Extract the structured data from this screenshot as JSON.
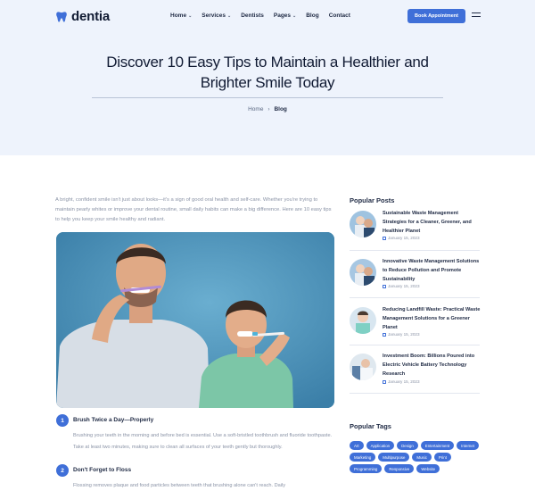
{
  "brand": {
    "name": "dentia",
    "accent": "#3f6fd8"
  },
  "nav": {
    "items": [
      {
        "label": "Home",
        "dropdown": true
      },
      {
        "label": "Services",
        "dropdown": true
      },
      {
        "label": "Dentists",
        "dropdown": false
      },
      {
        "label": "Pages",
        "dropdown": true
      },
      {
        "label": "Blog",
        "dropdown": false
      },
      {
        "label": "Contact",
        "dropdown": false
      }
    ],
    "cta": "Book Appointment",
    "menu_icon": "hamburger-icon"
  },
  "hero": {
    "title": "Discover 10 Easy Tips to Maintain a Healthier and Brighter Smile Today",
    "breadcrumb": {
      "home": "Home",
      "separator": "›",
      "current": "Blog"
    }
  },
  "article": {
    "intro": "A bright, confident smile isn't just about looks—it's a sign of good oral health and self-care. Whether you're trying to maintain pearly whites or improve your dental routine, small daily habits can make a big difference. Here are 10 easy tips to help you keep your smile healthy and radiant.",
    "steps": [
      {
        "number": "1",
        "title": "Brush Twice a Day—Properly",
        "text": "Brushing your teeth in the morning and before bed is essential. Use a soft-bristled toothbrush and fluoride toothpaste. Take at least two minutes, making sure to clean all surfaces of your teeth gently but thoroughly."
      },
      {
        "number": "2",
        "title": "Don't Forget to Floss",
        "text": "Flossing removes plaque and food particles between teeth that brushing alone can't reach. Daily"
      }
    ]
  },
  "sidebar": {
    "popular_posts_heading": "Popular Posts",
    "posts": [
      {
        "title": "Sustainable Waste Management Strategies for a Cleaner, Greener, and Healthier Planet",
        "date": "January 15, 2023"
      },
      {
        "title": "Innovative Waste Management Solutions to Reduce Pollution and Promote Sustainability",
        "date": "January 15, 2023"
      },
      {
        "title": "Reducing Landfill Waste: Practical Waste Management Solutions for a Greener Planet",
        "date": "January 15, 2023"
      },
      {
        "title": "Investment Boom: Billions Poured into Electric Vehicle Battery Technology Research",
        "date": "January 15, 2023"
      }
    ],
    "popular_tags_heading": "Popular Tags",
    "tags": [
      "Art",
      "Application",
      "Design",
      "Entertainment",
      "Internet",
      "Marketing",
      "Multipurpose",
      "Music",
      "Print",
      "Programming",
      "Responsive",
      "Website"
    ]
  }
}
